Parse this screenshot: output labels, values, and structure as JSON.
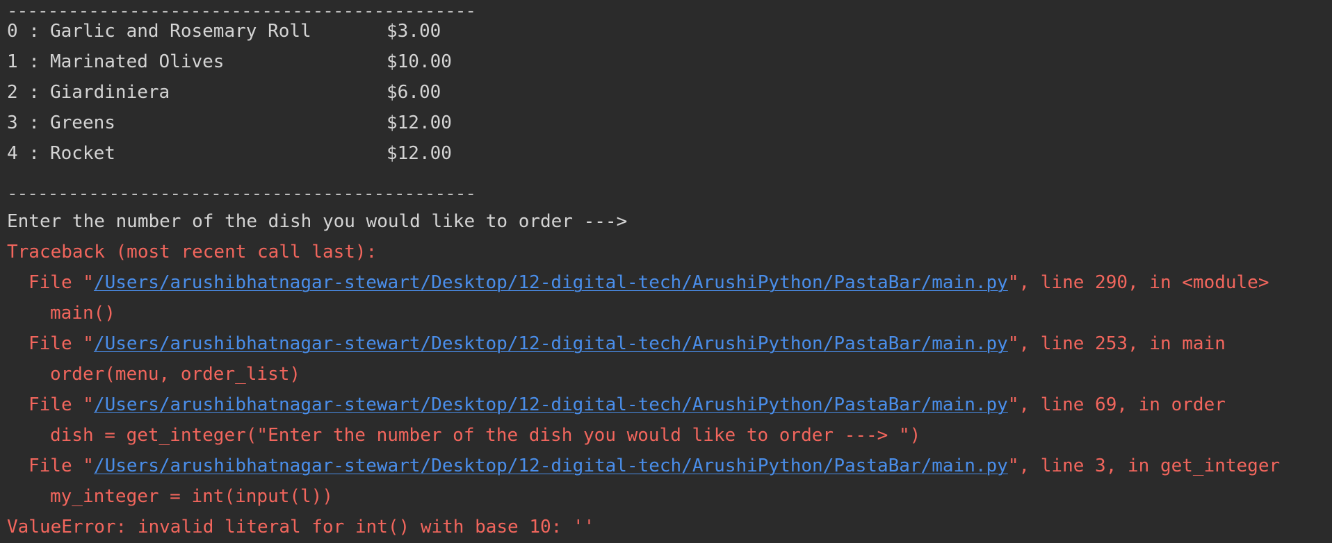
{
  "separator": "----------------------------------------------",
  "menu": [
    {
      "num": "0 :",
      "name": "Garlic and Rosemary Roll",
      "price": "$3.00"
    },
    {
      "num": "1 :",
      "name": "Marinated Olives",
      "price": "$10.00"
    },
    {
      "num": "2 :",
      "name": "Giardiniera",
      "price": "$6.00"
    },
    {
      "num": "3 :",
      "name": "Greens",
      "price": "$12.00"
    },
    {
      "num": "4 :",
      "name": "Rocket",
      "price": "$12.00"
    }
  ],
  "prompt": "Enter the number of the dish you would like to order --->",
  "traceback_header": "Traceback (most recent call last):",
  "frames": [
    {
      "prefix": "File \"",
      "path": "/Users/arushibhatnagar-stewart/Desktop/12-digital-tech/ArushiPython/PastaBar/main.py",
      "suffix": "\", line 290, in <module>",
      "code": "main()"
    },
    {
      "prefix": "File \"",
      "path": "/Users/arushibhatnagar-stewart/Desktop/12-digital-tech/ArushiPython/PastaBar/main.py",
      "suffix": "\", line 253, in main",
      "code": "order(menu, order_list)"
    },
    {
      "prefix": "File \"",
      "path": "/Users/arushibhatnagar-stewart/Desktop/12-digital-tech/ArushiPython/PastaBar/main.py",
      "suffix": "\", line 69, in order",
      "code": "dish = get_integer(\"Enter the number of the dish you would like to order ---> \")"
    },
    {
      "prefix": "File \"",
      "path": "/Users/arushibhatnagar-stewart/Desktop/12-digital-tech/ArushiPython/PastaBar/main.py",
      "suffix": "\", line 3, in get_integer",
      "code": "my_integer = int(input(l))"
    }
  ],
  "error_message": "ValueError: invalid literal for int() with base 10: ''",
  "colors": {
    "background": "#2b2b2b",
    "stdout": "#d4d4d4",
    "stderr": "#f2665d",
    "link": "#4a8eea"
  }
}
